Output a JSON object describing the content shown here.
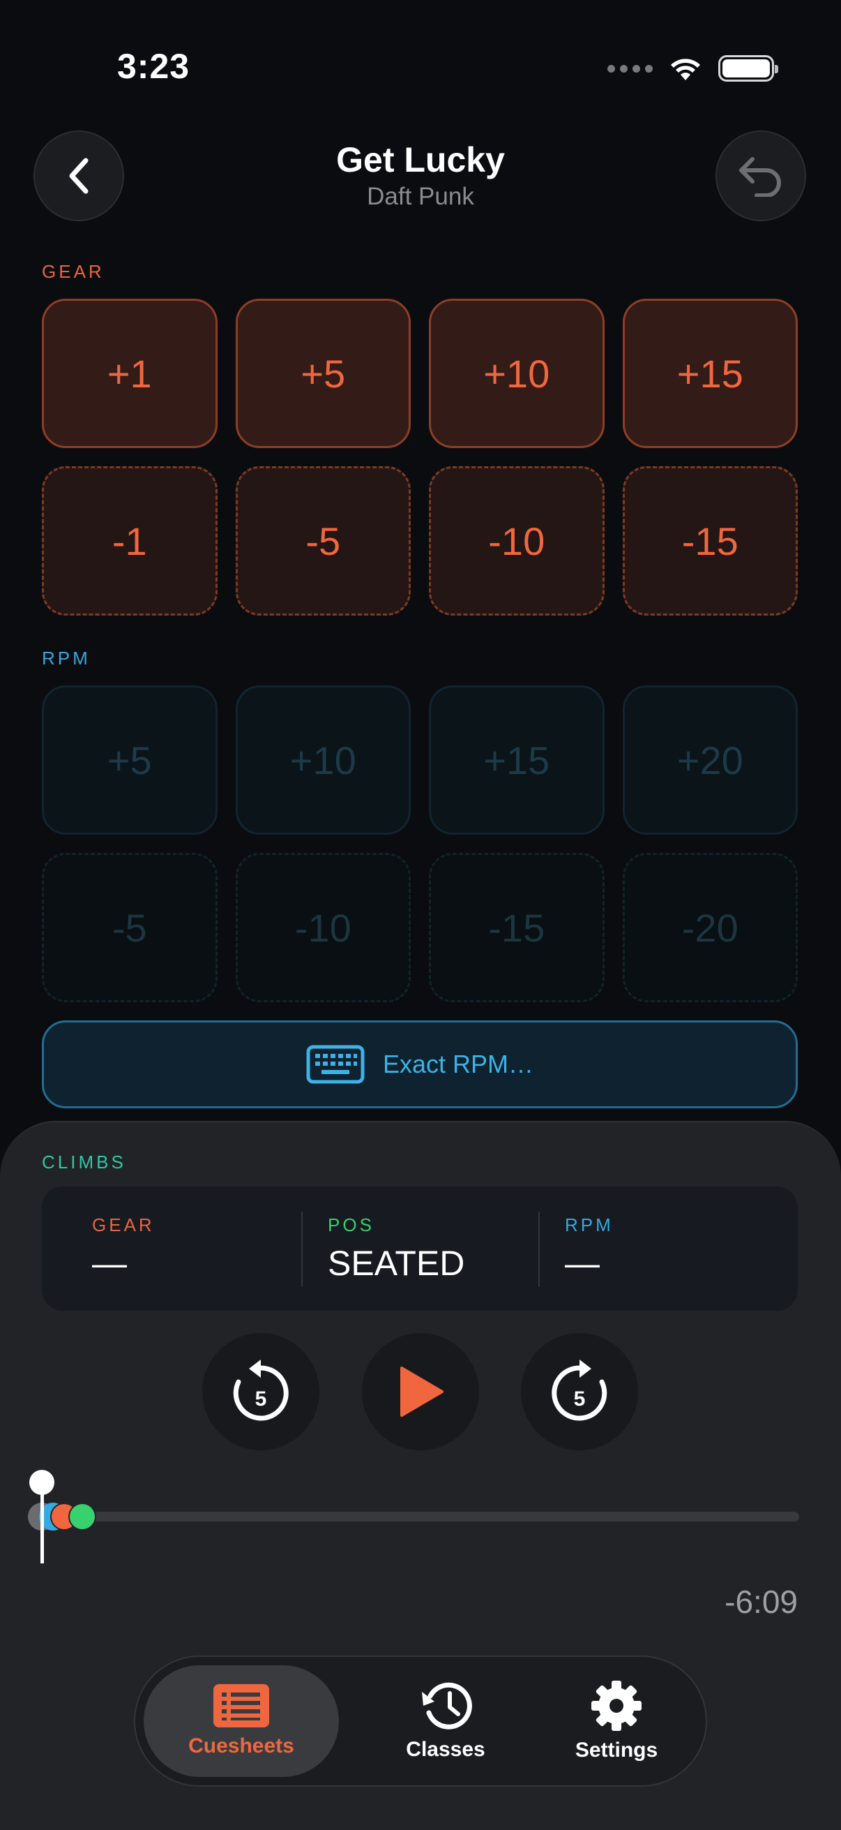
{
  "status_bar": {
    "time": "3:23"
  },
  "header": {
    "title": "Get Lucky",
    "artist": "Daft Punk"
  },
  "gear": {
    "label": "GEAR",
    "increase": [
      "+1",
      "+5",
      "+10",
      "+15"
    ],
    "decrease": [
      "-1",
      "-5",
      "-10",
      "-15"
    ]
  },
  "rpm": {
    "label": "RPM",
    "increase": [
      "+5",
      "+10",
      "+15",
      "+20"
    ],
    "decrease": [
      "-5",
      "-10",
      "-15",
      "-20"
    ],
    "exact_label": "Exact RPM…"
  },
  "climbs": {
    "label": "CLIMBS",
    "gear": {
      "label": "GEAR",
      "value": "—"
    },
    "pos": {
      "label": "POS",
      "value": "SEATED"
    },
    "rpm": {
      "label": "RPM",
      "value": "—"
    }
  },
  "playback": {
    "rewind_seconds": "5",
    "forward_seconds": "5",
    "remaining": "-6:09",
    "progress": 0.0
  },
  "tabs": [
    {
      "label": "Cuesheets",
      "icon": "list-icon",
      "active": true
    },
    {
      "label": "Classes",
      "icon": "history-icon",
      "active": false
    },
    {
      "label": "Settings",
      "icon": "gear-icon",
      "active": false
    }
  ],
  "colors": {
    "background": "#0b0c0f",
    "gear_accent": "#f0673f",
    "rpm_accent": "#36a9e0",
    "climbs_accent": "#2ec8a6",
    "pos_accent": "#39d06e"
  }
}
